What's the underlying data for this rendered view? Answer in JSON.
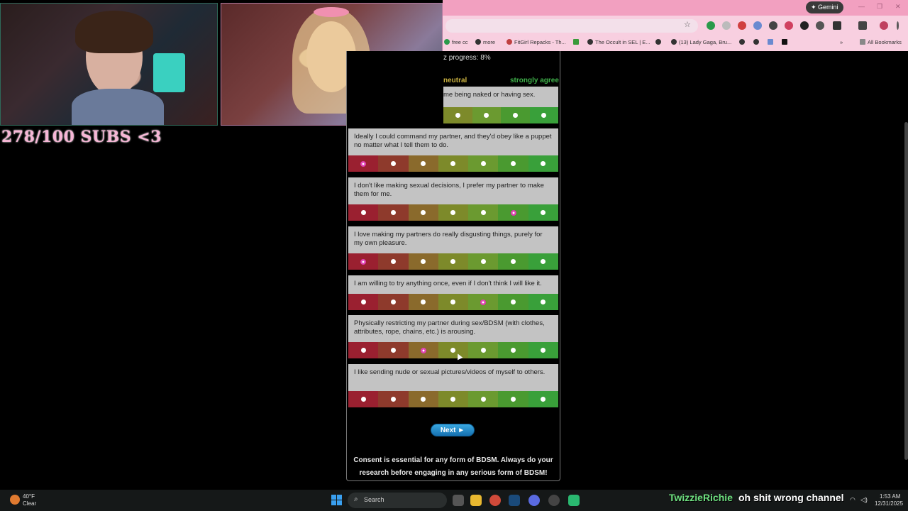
{
  "stream": {
    "sub_counter": "278/100 SUBS <3",
    "chat_user": "TwizzieRichie",
    "chat_message": "oh shit wrong channel"
  },
  "browser": {
    "gemini_label": "Gemini",
    "bookmarks": [
      "free cc",
      "more",
      "FitGirl Repacks - Th...",
      "The Occult in SEL | E...",
      "(13) Lady Gaga, Bru...",
      "All Bookmarks"
    ]
  },
  "quiz": {
    "progress": "z progress: 8%",
    "scale_neutral": "neutral",
    "scale_agree": "strongly agree",
    "questions": [
      {
        "text": "me being naked or having sex.",
        "selected": -1
      },
      {
        "text": "Ideally I could command my partner, and they'd obey like a puppet no matter what I tell them to do.",
        "selected": 0
      },
      {
        "text": "I don't like making sexual decisions, I prefer my partner to make them for me.",
        "selected": 5
      },
      {
        "text": "I love making my partners do really disgusting things, purely for my own pleasure.",
        "selected": 0
      },
      {
        "text": "I am willing to try anything once, even if I don't think I will like it.",
        "selected": 4
      },
      {
        "text": "Physically restricting my partner during sex/BDSM (with clothes, attributes, rope, chains, etc.) is arousing.",
        "selected": 2
      },
      {
        "text": "I like sending nude or sexual pictures/videos of myself to others.",
        "selected": -1
      }
    ],
    "next_label": "Next ►",
    "consent": "Consent is essential for any form of BDSM. Always do your research before engaging in any serious form of BDSM!"
  },
  "taskbar": {
    "weather_temp": "40°F",
    "weather_cond": "Clear",
    "search_label": "Search",
    "time": "1:53 AM",
    "date": "12/31/2025"
  }
}
